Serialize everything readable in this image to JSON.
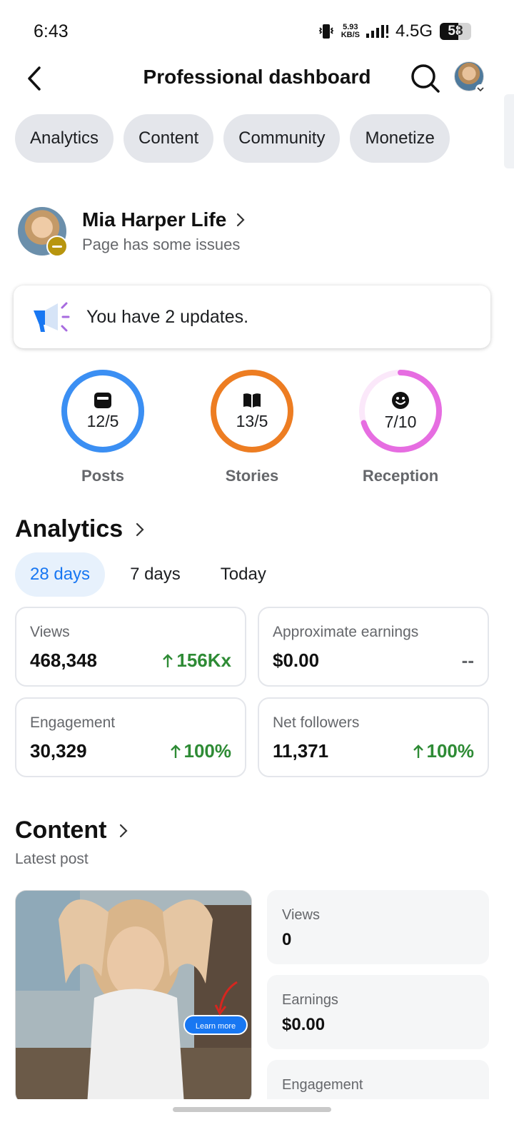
{
  "status_bar": {
    "time": "6:43",
    "speed_value": "5.93",
    "speed_unit": "KB/S",
    "network": "4.5G",
    "battery": "58",
    "battery_level": 0.58
  },
  "header": {
    "title": "Professional dashboard"
  },
  "tabs": [
    {
      "label": "Analytics"
    },
    {
      "label": "Content"
    },
    {
      "label": "Community"
    },
    {
      "label": "Monetize"
    }
  ],
  "profile": {
    "name": "Mia Harper Life",
    "status": "Page has some issues"
  },
  "updates": {
    "text": "You have 2 updates."
  },
  "rings": [
    {
      "value": "12/5",
      "label": "Posts",
      "color": "#3b8ff3",
      "progress": 1.0
    },
    {
      "value": "13/5",
      "label": "Stories",
      "color": "#ed7d22",
      "progress": 1.0
    },
    {
      "value": "7/10",
      "label": "Reception",
      "color": "#e66de1",
      "progress": 0.7
    }
  ],
  "analytics": {
    "title": "Analytics",
    "periods": [
      "28 days",
      "7 days",
      "Today"
    ],
    "metrics": [
      {
        "label": "Views",
        "value": "468,348",
        "change": "156Kx"
      },
      {
        "label": "Approximate earnings",
        "value": "$0.00",
        "change": "--"
      },
      {
        "label": "Engagement",
        "value": "30,329",
        "change": "100%"
      },
      {
        "label": "Net followers",
        "value": "11,371",
        "change": "100%"
      }
    ]
  },
  "content": {
    "title": "Content",
    "subtitle": "Latest post",
    "post_button": "Learn more",
    "stats": [
      {
        "label": "Views",
        "value": "0"
      },
      {
        "label": "Earnings",
        "value": "$0.00"
      },
      {
        "label": "Engagement",
        "value": ""
      }
    ]
  },
  "colors": {
    "accent": "#1877f2",
    "positive": "#2e8b35",
    "chip_bg": "#e4e6eb",
    "badge_warning": "#b8950e"
  }
}
